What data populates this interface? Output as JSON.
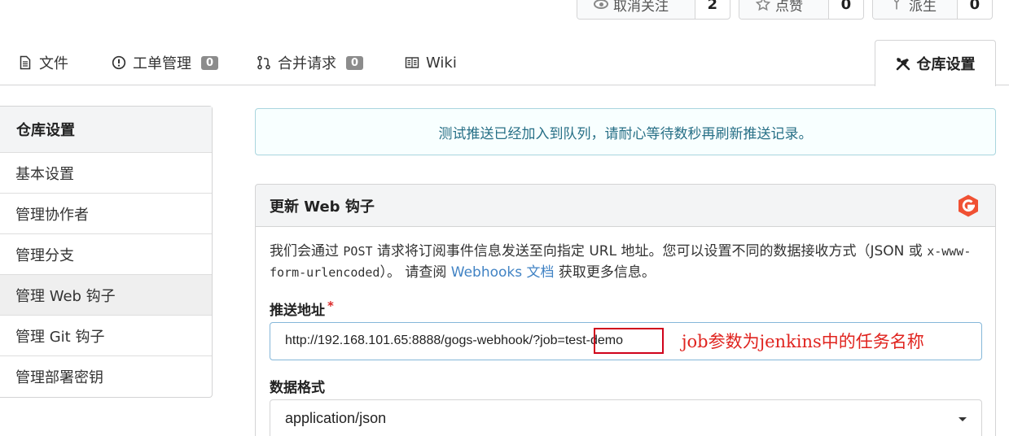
{
  "header_actions": {
    "unwatch": {
      "label": "取消关注",
      "count": "2"
    },
    "star": {
      "label": "点赞",
      "count": "0"
    },
    "fork": {
      "label": "派生",
      "count": "0"
    }
  },
  "tabs": [
    {
      "label": "文件",
      "icon": "file-icon"
    },
    {
      "label": "工单管理",
      "badge": "0",
      "icon": "issue-icon"
    },
    {
      "label": "合并请求",
      "badge": "0",
      "icon": "pull-request-icon"
    },
    {
      "label": "Wiki",
      "icon": "book-icon"
    }
  ],
  "active_tab": {
    "label": "仓库设置",
    "icon": "tools-icon"
  },
  "sidebar": {
    "title": "仓库设置",
    "items": [
      {
        "label": "基本设置"
      },
      {
        "label": "管理协作者"
      },
      {
        "label": "管理分支"
      },
      {
        "label": "管理 Web 钩子"
      },
      {
        "label": "管理 Git 钩子"
      },
      {
        "label": "管理部署密钥"
      }
    ]
  },
  "info_message": "测试推送已经加入到队列，请耐心等待数秒再刷新推送记录。",
  "form": {
    "title": "更新 Web 钩子",
    "desc_part1": "我们会通过 ",
    "desc_code1": "POST",
    "desc_part2": " 请求将订阅事件信息发送至向指定 URL 地址。您可以设置不同的数据接收方式（JSON 或 ",
    "desc_code2": "x-www-form-urlencoded",
    "desc_part3": "）。 请查阅 ",
    "desc_link": "Webhooks 文档",
    "desc_part4": " 获取更多信息。",
    "url_label": "推送地址",
    "required_mark": "*",
    "url_value": "http://192.168.101.65:8888/gogs-webhook/?job=test-demo",
    "annotation": "job参数为jenkins中的任务名称",
    "format_label": "数据格式",
    "format_value": "application/json"
  },
  "colors": {
    "info_text": "#276f86",
    "link": "#4183c4",
    "annotation": "#e0241f",
    "gogs_logo": "#f05133"
  }
}
